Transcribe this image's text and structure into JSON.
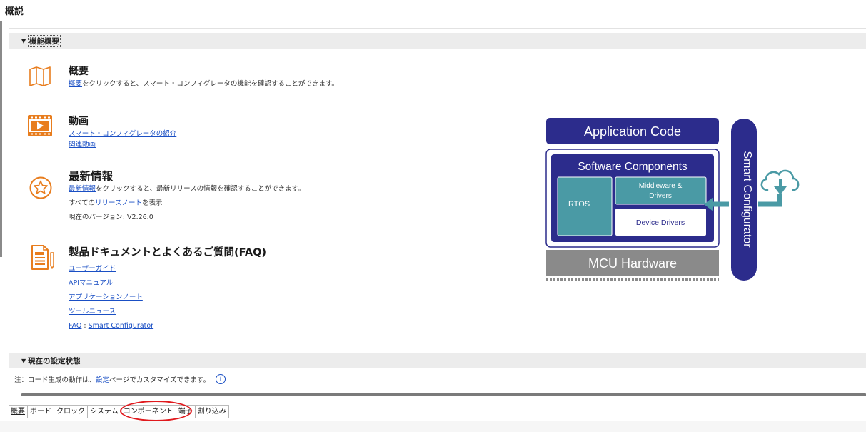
{
  "page_title": "概説",
  "sections": {
    "features": {
      "label": "機能概要"
    },
    "current_settings": {
      "label": "現在の設定状態"
    }
  },
  "overview": {
    "title": "概要",
    "desc_link": "概要",
    "desc_text": "をクリックすると、スマート・コンフィグレータの機能を確認することができます。",
    "icon": "map-icon"
  },
  "videos": {
    "title": "動画",
    "links": [
      "スマート・コンフィグレータの紹介",
      "関連動画"
    ],
    "icon": "video-icon"
  },
  "news": {
    "title": "最新情報",
    "desc_link": "最新情報",
    "desc_text": "をクリックすると、最新リリースの情報を確認することができます。",
    "release_prefix": "すべての",
    "release_link": "リリースノート",
    "release_suffix": "を表示",
    "version": "現在のバージョン: V2.26.0",
    "icon": "star-badge-icon"
  },
  "docs": {
    "title": "製品ドキュメントとよくあるご質問(FAQ)",
    "links": [
      "ユーザーガイド",
      "APIマニュアル",
      "アプリケーションノート",
      "ツールニュース"
    ],
    "faq_link": "FAQ",
    "faq_sep": " : ",
    "faq_link2": "Smart Configurator",
    "icon": "document-icon"
  },
  "diagram": {
    "app_code": "Application Code",
    "software_components": "Software Components",
    "rtos": "RTOS",
    "middleware": "Middleware &",
    "drivers": "Drivers",
    "device_drivers": "Device Drivers",
    "mcu_hardware": "MCU Hardware",
    "smart_configurator": "Smart Configurator"
  },
  "note": {
    "prefix": "注：コード生成の動作は、",
    "link": "設定",
    "suffix": " ページでカスタマイズできます。"
  },
  "tabs": [
    "概要",
    "ボード",
    "クロック",
    "システム",
    "コンポーネント",
    "端子",
    "割り込み"
  ],
  "colors": {
    "navy": "#2c2c8c",
    "teal": "#4a9aa5",
    "orange": "#e87d1e",
    "link": "#1a4fc4",
    "highlight": "#e0191d"
  }
}
